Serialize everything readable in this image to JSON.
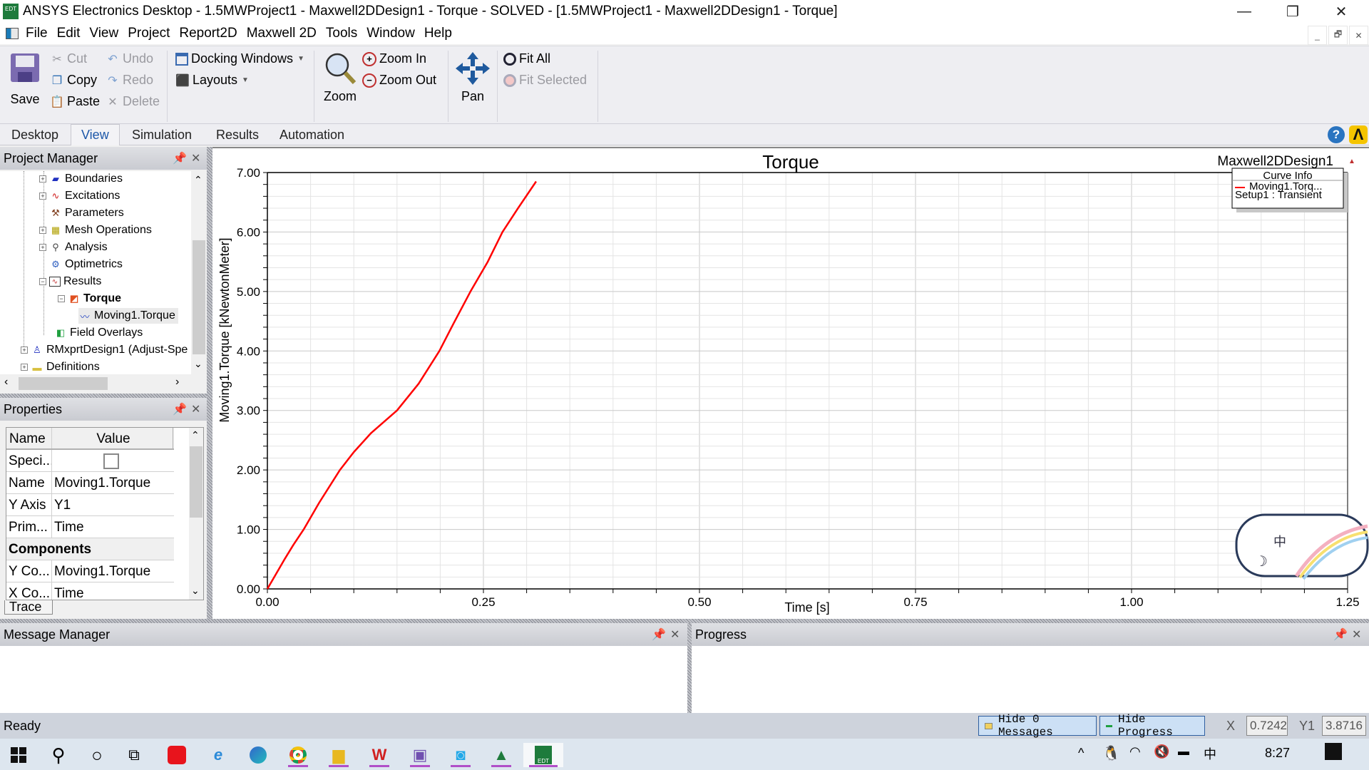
{
  "window": {
    "title": "ANSYS Electronics Desktop - 1.5MWProject1 - Maxwell2DDesign1 - Torque - SOLVED - [1.5MWProject1 - Maxwell2DDesign1 - Torque]",
    "app_icon": "EDT",
    "minimize": "—",
    "restore": "❐",
    "close": "✕"
  },
  "menu": [
    "File",
    "Edit",
    "View",
    "Project",
    "Report2D",
    "Maxwell 2D",
    "Tools",
    "Window",
    "Help"
  ],
  "mdi": {
    "minimize": "_",
    "restore": "🗗",
    "close": "✕"
  },
  "ribbon": {
    "save": "Save",
    "cut": "Cut",
    "copy": "Copy",
    "paste": "Paste",
    "undo": "Undo",
    "redo": "Redo",
    "delete": "Delete",
    "docking_windows": "Docking Windows",
    "layouts": "Layouts",
    "zoom": "Zoom",
    "zoom_in": "Zoom In",
    "zoom_out": "Zoom Out",
    "pan": "Pan",
    "fit_all": "Fit All",
    "fit_selected": "Fit Selected"
  },
  "tabs": [
    "Desktop",
    "View",
    "Simulation",
    "Results",
    "Automation"
  ],
  "active_tab": "View",
  "project_manager": {
    "title": "Project Manager",
    "tree": [
      {
        "label": "Boundaries",
        "icon": "boundaries-icon",
        "expand": "+"
      },
      {
        "label": "Excitations",
        "icon": "excitations-icon",
        "expand": "+"
      },
      {
        "label": "Parameters",
        "icon": "parameters-icon",
        "expand": ""
      },
      {
        "label": "Mesh Operations",
        "icon": "mesh-icon",
        "expand": "+"
      },
      {
        "label": "Analysis",
        "icon": "analysis-icon",
        "expand": "+"
      },
      {
        "label": "Optimetrics",
        "icon": "optimetrics-icon",
        "expand": ""
      },
      {
        "label": "Results",
        "icon": "results-icon",
        "expand": "−"
      },
      {
        "label": "Torque",
        "icon": "report-icon",
        "expand": "−"
      },
      {
        "label": "Moving1.Torque",
        "icon": "trace-icon",
        "expand": ""
      },
      {
        "label": "Field Overlays",
        "icon": "field-overlays-icon",
        "expand": ""
      },
      {
        "label": "RMxprtDesign1 (Adjust-Spe",
        "icon": "rmxprt-icon",
        "expand": "+"
      },
      {
        "label": "Definitions",
        "icon": "folder-icon",
        "expand": "+"
      }
    ]
  },
  "properties": {
    "title": "Properties",
    "col_name": "Name",
    "col_value": "Value",
    "rows": [
      {
        "name": "Speci...",
        "value": "",
        "checkbox": true
      },
      {
        "name": "Name",
        "value": "Moving1.Torque"
      },
      {
        "name": "Y Axis",
        "value": "Y1"
      },
      {
        "name": "Prim...",
        "value": "Time"
      },
      {
        "name": "Components",
        "value": "",
        "section": true
      },
      {
        "name": "Y Co...",
        "value": "Moving1.Torque"
      },
      {
        "name": "X Co...",
        "value": "Time"
      }
    ],
    "tab": "Trace"
  },
  "chart_data": {
    "type": "line",
    "title": "Torque",
    "design_label": "Maxwell2DDesign1",
    "xlabel": "Time [s]",
    "ylabel": "Moving1.Torque [kNewtonMeter]",
    "xlim": [
      0,
      1.25
    ],
    "ylim": [
      0,
      7
    ],
    "xticks": [
      "0.00",
      "0.25",
      "0.50",
      "0.75",
      "1.00",
      "1.25"
    ],
    "yticks": [
      "0.00",
      "1.00",
      "2.00",
      "3.00",
      "4.00",
      "5.00",
      "6.00",
      "7.00"
    ],
    "grid": true,
    "legend": {
      "title": "Curve Info",
      "placement": "top-right",
      "entries": [
        {
          "name": "Moving1.Torq...",
          "sub": "Setup1 : Transient",
          "color": "#ff0000"
        }
      ]
    },
    "series": [
      {
        "name": "Moving1.Torque",
        "color": "#ff0000",
        "x": [
          0.0,
          0.01,
          0.02,
          0.03,
          0.042,
          0.06,
          0.084,
          0.1,
          0.12,
          0.15,
          0.175,
          0.199,
          0.215,
          0.235,
          0.255,
          0.272,
          0.29,
          0.311
        ],
        "y": [
          0.0,
          0.25,
          0.5,
          0.74,
          1.0,
          1.45,
          2.0,
          2.3,
          2.62,
          3.0,
          3.45,
          4.0,
          4.45,
          5.0,
          5.5,
          6.0,
          6.4,
          6.85
        ]
      }
    ]
  },
  "message_manager": {
    "title": "Message Manager"
  },
  "progress": {
    "title": "Progress"
  },
  "status": {
    "text": "Ready",
    "hide_messages": "Hide 0 Messages",
    "hide_progress": "Hide Progress",
    "x_label": "X",
    "x_value": "0.7242",
    "y_label": "Y1",
    "y_value": "3.8716"
  },
  "taskbar": {
    "time": "8:27",
    "ime": "中",
    "icons": [
      "windows-start-icon",
      "search-icon",
      "cortana-icon",
      "task-view-icon",
      "youdao-icon",
      "ie-icon",
      "edge-icon",
      "chrome-icon",
      "file-explorer-icon",
      "wps-icon",
      "paint-app-icon",
      "file-transfer-icon",
      "app-icon",
      "ansys-edt-icon"
    ]
  }
}
